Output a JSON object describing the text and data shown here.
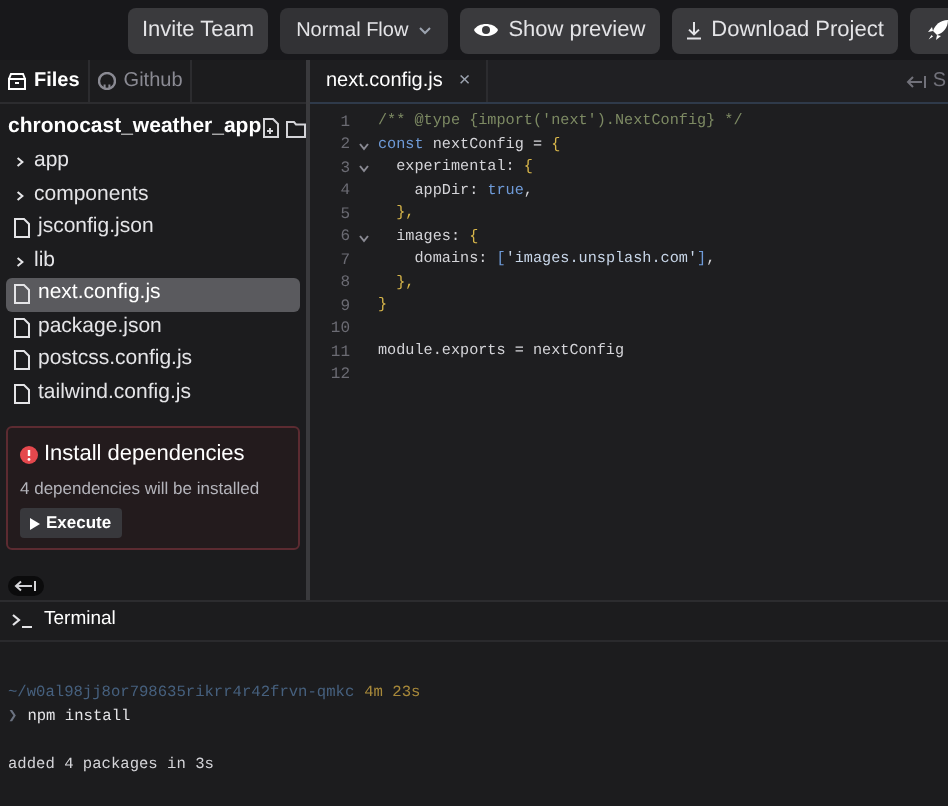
{
  "toolbar": {
    "buttons": [
      {
        "label": "Invite Team",
        "kind": "plain"
      },
      {
        "label": "Normal Flow",
        "kind": "dropdown"
      },
      {
        "label": "Show preview",
        "kind": "eye"
      },
      {
        "label": "Download Project",
        "kind": "download"
      },
      {
        "kind": "rocket"
      }
    ]
  },
  "sidebar": {
    "tabs": [
      {
        "label": "Files",
        "selected": true
      },
      {
        "label": "Github",
        "selected": false
      }
    ],
    "project": "chronocast_weather_app",
    "items": [
      {
        "name": "app",
        "kind": "folder",
        "expanded": false,
        "selected": false
      },
      {
        "name": "components",
        "kind": "folder",
        "expanded": false,
        "selected": false
      },
      {
        "name": "jsconfig.json",
        "kind": "file",
        "selected": false
      },
      {
        "name": "lib",
        "kind": "folder",
        "expanded": false,
        "selected": false
      },
      {
        "name": "next.config.js",
        "kind": "file",
        "selected": true
      },
      {
        "name": "package.json",
        "kind": "file",
        "selected": false
      },
      {
        "name": "postcss.config.js",
        "kind": "file",
        "selected": false
      },
      {
        "name": "tailwind.config.js",
        "kind": "file",
        "selected": false
      }
    ],
    "alert": {
      "title": "Install dependencies",
      "message": "4 dependencies will be installed",
      "button": "Execute"
    }
  },
  "editor": {
    "tab": "next.config.js",
    "close": "×",
    "right_tab": "S",
    "lines": [
      {
        "number": "1",
        "fold": false,
        "tokens": [
          {
            "text": "/** @type {import('next').NextConfig} */",
            "kind": "comment"
          }
        ]
      },
      {
        "number": "2",
        "fold": true,
        "tokens": [
          {
            "text": "const",
            "kind": "keyword"
          },
          {
            "text": " nextConfig = ",
            "kind": "ident"
          },
          {
            "text": "{",
            "kind": "brace"
          }
        ]
      },
      {
        "number": "3",
        "fold": true,
        "tokens": [
          {
            "text": "  experimental: ",
            "kind": "ident"
          },
          {
            "text": "{",
            "kind": "brace"
          }
        ]
      },
      {
        "number": "4",
        "fold": false,
        "tokens": [
          {
            "text": "    appDir: ",
            "kind": "ident"
          },
          {
            "text": "true",
            "kind": "keyword"
          },
          {
            "text": ",",
            "kind": "ident"
          }
        ]
      },
      {
        "number": "5",
        "fold": false,
        "tokens": [
          {
            "text": "  },",
            "kind": "brace"
          }
        ]
      },
      {
        "number": "6",
        "fold": true,
        "tokens": [
          {
            "text": "  images: ",
            "kind": "ident"
          },
          {
            "text": "{",
            "kind": "brace"
          }
        ]
      },
      {
        "number": "7",
        "fold": false,
        "tokens": [
          {
            "text": "    domains: ",
            "kind": "ident"
          },
          {
            "text": "[",
            "kind": "keyword"
          },
          {
            "text": "'images.unsplash.com'",
            "kind": "string"
          },
          {
            "text": "]",
            "kind": "keyword"
          },
          {
            "text": ",",
            "kind": "ident"
          }
        ]
      },
      {
        "number": "8",
        "fold": false,
        "tokens": [
          {
            "text": "  },",
            "kind": "brace"
          }
        ]
      },
      {
        "number": "9",
        "fold": false,
        "tokens": [
          {
            "text": "}",
            "kind": "brace"
          }
        ]
      },
      {
        "number": "10",
        "fold": false
      },
      {
        "number": "11",
        "fold": false,
        "tokens": [
          {
            "text": "module.exports = nextConfig",
            "kind": "ident"
          }
        ]
      },
      {
        "number": "12",
        "fold": false
      }
    ]
  },
  "terminal": {
    "title": "Terminal",
    "path": "~/w0al98jj8or798635rikrr4r42frvn-qmkc",
    "duration": "4m 23s",
    "prompt": "❯",
    "command": "npm install",
    "output": "added 4 packages in 3s"
  }
}
